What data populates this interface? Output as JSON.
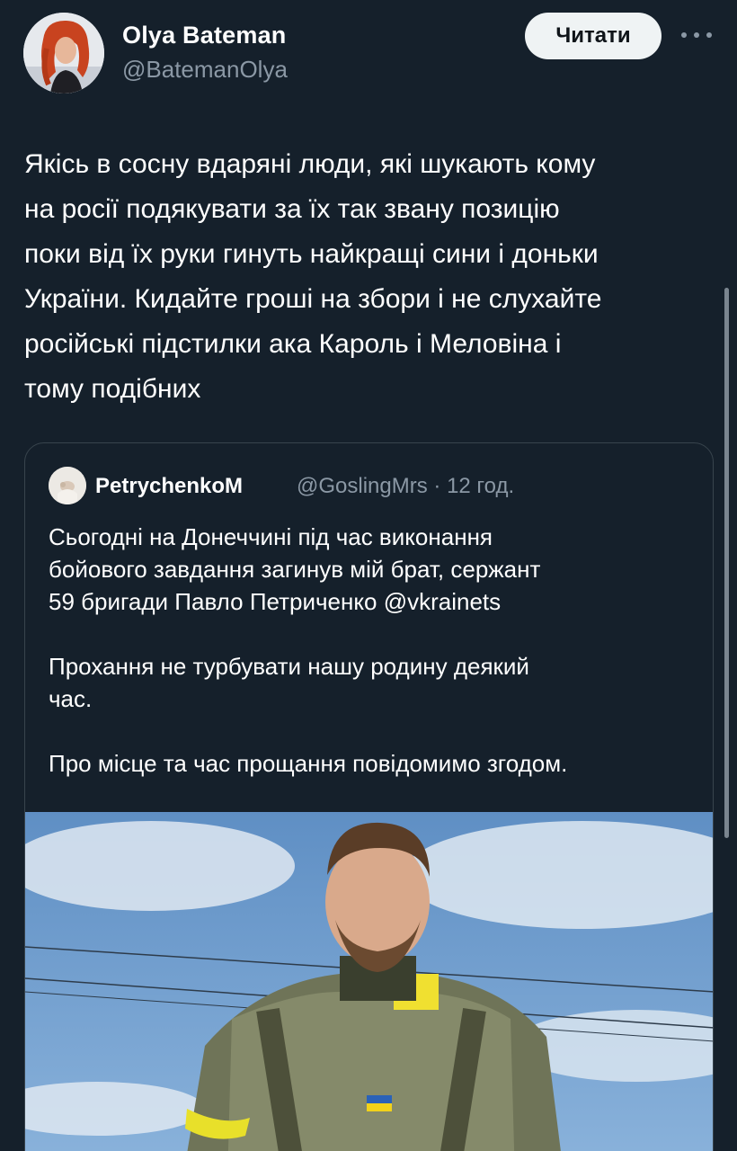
{
  "author": {
    "name": "Olya Bateman",
    "handle": "@BatemanOlya",
    "avatar_icon": "profile-photo-red-hair"
  },
  "follow_button_label": "Читати",
  "more_icon": "more-horizontal-icon",
  "tweet_text": "Якісь в сосну вдаряні люди, які шукають кому\nна росії подякувати за їх так звану позицію\nпоки від їх руки гинуть найкращі сини і доньки\nУкраїни. Кидайте гроші на збори і не слухайте\nросійські підстилки ака Кароль і Меловіна і\nтому подібних",
  "quoted_tweet": {
    "author_name": "PetrychenkoM",
    "handle": "@GoslingMrs",
    "time": "· 12 год.",
    "text": "Сьогодні на Донеччині під час виконання\nбойового завдання загинув мій брат, сержант\n59 бригади Павло Петриченко @vkrainets\n\nПрохання не турбувати нашу родину деякий\nчас.\n\nПро місце та час прощання повідомимо згодом.",
    "photo": "soldier-portrait-photo"
  },
  "colors": {
    "background": "#15202b",
    "text_primary": "#ffffff",
    "text_secondary": "#8b98a5",
    "border": "#38444d",
    "button_bg": "#eff3f4"
  }
}
